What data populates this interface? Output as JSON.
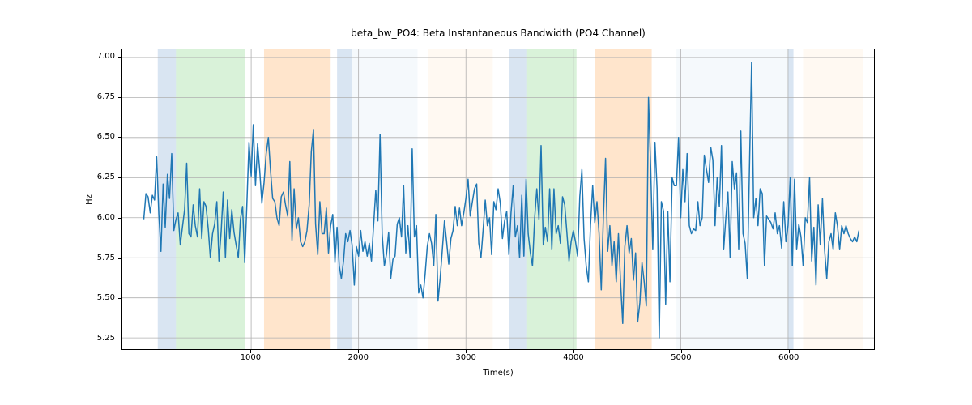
{
  "chart_data": {
    "type": "line",
    "title": "beta_bw_PO4: Beta Instantaneous Bandwidth (PO4 Channel)",
    "xlabel": "Time(s)",
    "ylabel": "Hz",
    "xlim": [
      -200,
      6800
    ],
    "ylim": [
      5.18,
      7.05
    ],
    "xticks": [
      1000,
      2000,
      3000,
      4000,
      5000,
      6000
    ],
    "yticks": [
      5.25,
      5.5,
      5.75,
      6.0,
      6.25,
      6.5,
      6.75,
      7.0
    ],
    "ytick_labels": [
      "5.25",
      "5.50",
      "5.75",
      "6.00",
      "6.25",
      "6.50",
      "6.75",
      "7.00"
    ],
    "spans": [
      {
        "x0": 130,
        "x1": 300,
        "color": "#6699cc"
      },
      {
        "x0": 300,
        "x1": 940,
        "color": "#66cc66"
      },
      {
        "x0": 1120,
        "x1": 1740,
        "color": "#ff9933"
      },
      {
        "x0": 1800,
        "x1": 1940,
        "color": "#6699cc"
      },
      {
        "x0": 1940,
        "x1": 2550,
        "color": "#d9e6f2"
      },
      {
        "x0": 2650,
        "x1": 3250,
        "color": "#ffe6cc"
      },
      {
        "x0": 3400,
        "x1": 3570,
        "color": "#6699cc"
      },
      {
        "x0": 3570,
        "x1": 4030,
        "color": "#66cc66"
      },
      {
        "x0": 4200,
        "x1": 4730,
        "color": "#ff9933"
      },
      {
        "x0": 4960,
        "x1": 6000,
        "color": "#d9e6f2"
      },
      {
        "x0": 6000,
        "x1": 6050,
        "color": "#6699cc"
      },
      {
        "x0": 6140,
        "x1": 6700,
        "color": "#ffe6cc"
      }
    ],
    "series": [
      {
        "name": "beta_bw_PO4",
        "x_start": 0,
        "x_step": 20,
        "values": [
          5.99,
          6.15,
          6.13,
          6.03,
          6.14,
          6.11,
          6.38,
          6.02,
          5.79,
          6.21,
          5.94,
          6.27,
          6.12,
          6.4,
          5.92,
          5.99,
          6.03,
          5.83,
          5.94,
          6.05,
          6.34,
          5.9,
          5.88,
          6.08,
          5.95,
          5.88,
          6.18,
          5.87,
          6.1,
          6.07,
          5.93,
          5.75,
          5.9,
          5.96,
          6.1,
          5.73,
          5.91,
          6.16,
          5.75,
          6.11,
          5.87,
          6.05,
          5.91,
          5.83,
          5.75,
          5.99,
          6.07,
          5.72,
          6.09,
          6.47,
          6.26,
          6.58,
          6.2,
          6.46,
          6.29,
          6.09,
          6.22,
          6.4,
          6.5,
          6.3,
          6.12,
          6.1,
          6.0,
          5.95,
          6.13,
          6.16,
          6.08,
          6.01,
          6.35,
          5.86,
          6.18,
          5.93,
          6.0,
          5.85,
          5.82,
          5.85,
          5.92,
          6.08,
          6.41,
          6.55,
          5.96,
          5.77,
          6.1,
          5.9,
          5.9,
          6.06,
          5.78,
          5.95,
          6.02,
          5.72,
          5.94,
          5.7,
          5.62,
          5.73,
          5.9,
          5.85,
          5.92,
          5.83,
          5.58,
          5.82,
          5.76,
          5.92,
          5.79,
          5.85,
          5.76,
          5.84,
          5.73,
          5.95,
          6.17,
          5.98,
          6.52,
          5.9,
          5.7,
          5.77,
          5.91,
          5.62,
          5.74,
          5.76,
          5.96,
          6.0,
          5.88,
          6.2,
          5.78,
          5.95,
          5.75,
          6.43,
          5.88,
          5.95,
          5.53,
          5.58,
          5.5,
          5.65,
          5.82,
          5.9,
          5.84,
          5.7,
          6.02,
          5.48,
          5.62,
          5.8,
          5.98,
          5.85,
          5.71,
          5.87,
          5.92,
          6.07,
          5.95,
          6.06,
          5.95,
          6.03,
          6.12,
          6.24,
          6.01,
          6.1,
          6.18,
          6.21,
          5.84,
          5.75,
          5.92,
          6.11,
          5.95,
          6.0,
          5.77,
          6.1,
          6.05,
          6.18,
          6.09,
          5.87,
          5.98,
          6.04,
          5.77,
          6.03,
          6.2,
          5.88,
          5.95,
          5.75,
          6.14,
          5.76,
          6.24,
          5.9,
          5.78,
          5.7,
          6.0,
          6.18,
          5.99,
          6.45,
          5.83,
          5.94,
          5.85,
          6.18,
          5.8,
          6.18,
          5.9,
          5.95,
          5.84,
          6.13,
          6.08,
          5.91,
          5.73,
          5.85,
          5.92,
          5.85,
          5.76,
          6.13,
          6.3,
          5.87,
          5.7,
          5.6,
          5.95,
          6.2,
          5.97,
          6.1,
          5.9,
          5.55,
          6.0,
          6.37,
          5.79,
          5.95,
          5.7,
          5.85,
          5.6,
          5.9,
          5.6,
          5.34,
          5.82,
          5.95,
          5.78,
          5.87,
          5.61,
          5.78,
          5.35,
          5.47,
          5.72,
          5.6,
          5.45,
          6.75,
          6.31,
          5.8,
          6.47,
          6.18,
          5.25,
          6.1,
          6.04,
          5.46,
          6.04,
          5.6,
          6.25,
          6.2,
          6.2,
          6.5,
          6.0,
          6.3,
          6.1,
          6.4,
          5.95,
          5.9,
          5.93,
          5.92,
          6.1,
          5.95,
          6.0,
          6.39,
          6.3,
          6.22,
          6.44,
          6.36,
          5.95,
          6.25,
          6.07,
          6.45,
          5.8,
          6.0,
          6.16,
          5.75,
          6.35,
          6.18,
          6.28,
          5.8,
          6.54,
          5.9,
          5.84,
          5.62,
          6.3,
          6.97,
          6.0,
          6.12,
          5.95,
          6.18,
          6.15,
          5.7,
          6.01,
          5.99,
          5.97,
          5.93,
          6.03,
          5.9,
          5.95,
          5.81,
          6.1,
          5.85,
          5.95,
          6.25,
          5.7,
          6.24,
          5.8,
          5.96,
          5.88,
          5.7,
          6.0,
          5.97,
          6.25,
          5.73,
          5.94,
          5.58,
          6.08,
          5.83,
          6.12,
          5.8,
          5.62,
          5.85,
          5.9,
          5.8,
          6.03,
          5.95,
          5.8,
          5.95,
          5.9,
          5.95,
          5.9,
          5.87,
          5.85,
          5.88,
          5.85,
          5.92
        ]
      }
    ]
  }
}
